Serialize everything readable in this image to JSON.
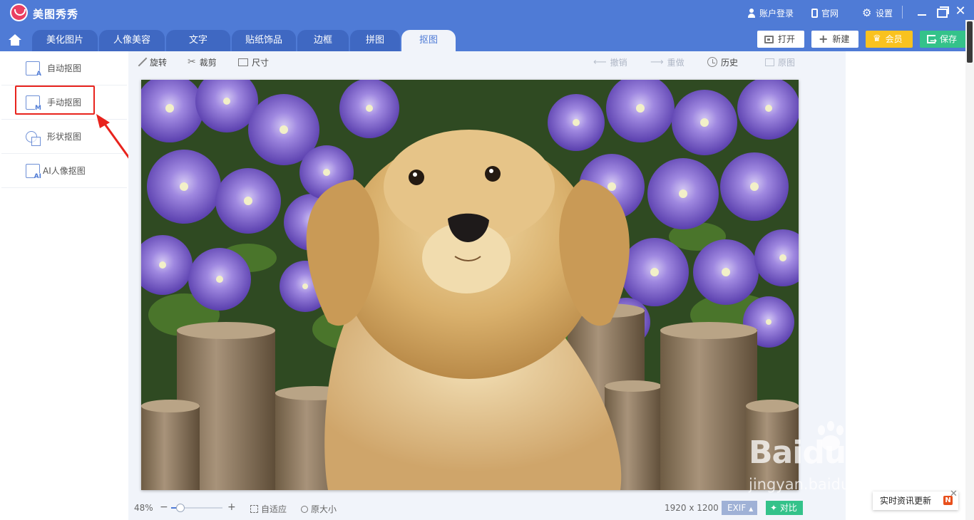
{
  "app": {
    "title": "美图秀秀"
  },
  "top_links": {
    "account": "账户登录",
    "website": "官网",
    "settings": "设置"
  },
  "tabs": [
    {
      "label": "美化图片"
    },
    {
      "label": "人像美容"
    },
    {
      "label": "文字"
    },
    {
      "label": "贴纸饰品"
    },
    {
      "label": "边框"
    },
    {
      "label": "拼图"
    },
    {
      "label": "抠图",
      "active": true
    }
  ],
  "header_buttons": {
    "open": "打开",
    "new": "新建",
    "vip": "会员",
    "save": "保存"
  },
  "left_panel": {
    "items": [
      {
        "label": "自动抠图",
        "icon": "auto-cutout-icon",
        "icon_letter": "A"
      },
      {
        "label": "手动抠图",
        "icon": "manual-cutout-icon",
        "icon_letter": "M"
      },
      {
        "label": "形状抠图",
        "icon": "shape-cutout-icon",
        "icon_letter": ""
      },
      {
        "label": "AI人像抠图",
        "icon": "ai-portrait-icon",
        "icon_letter": "AI"
      }
    ],
    "highlighted": "手动抠图"
  },
  "toolbar": {
    "rotate": "旋转",
    "crop": "裁剪",
    "size": "尺寸",
    "undo": "撤销",
    "redo": "重做",
    "history": "历史",
    "original": "原图"
  },
  "status_bar": {
    "zoom": "48%",
    "zoom_fraction": 0.48,
    "minus": "−",
    "plus": "+",
    "fit": "自适应",
    "actual_size": "原大小",
    "dimensions": "1920 x 1200",
    "exif": "EXIF",
    "exif_caret": "▲",
    "compare": "对比"
  },
  "watermark": {
    "logo": "Bai",
    "logo_tail": "du",
    "chinese": "经验",
    "url": "jingyan.baidu.com"
  },
  "news_widget": {
    "text": "实时资讯更新",
    "badge": "N",
    "close": "✕"
  },
  "window_controls": {
    "close": "✕"
  },
  "colors": {
    "titlebar": "#4f7bd6",
    "highlight": "#e8231d",
    "gold": "#f9c21f",
    "green": "#34c28a"
  }
}
